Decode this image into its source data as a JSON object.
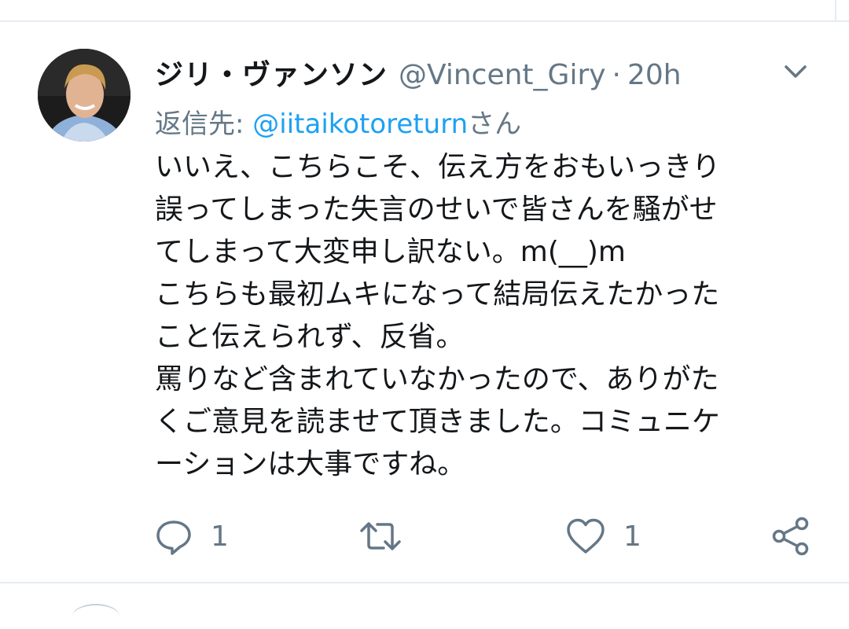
{
  "tweet": {
    "display_name": "ジリ・ヴァンソン",
    "handle": "@Vincent_Giry",
    "separator": "·",
    "time": "20h",
    "reply_prefix": "返信先: ",
    "reply_mention": "@iitaikotoreturn",
    "reply_suffix": "さん",
    "text_lines": [
      "いいえ、こちらこそ、伝え方をおもいっきり",
      "誤ってしまった失言のせいで皆さんを騒がせ",
      "てしまって大変申し訳ない。m(__)m",
      "こちらも最初ムキになって結局伝えたかった",
      "こと伝えられず、反省。",
      "罵りなど含まれていなかったので、ありがた",
      "くご意見を読ませて頂きました。コミュニケ",
      "ーションは大事ですね。"
    ]
  },
  "actions": {
    "reply_count": "1",
    "like_count": "1"
  },
  "icons": {
    "reply": "reply-bubble-icon",
    "retweet": "retweet-icon",
    "like": "heart-icon",
    "share": "share-icon",
    "menu": "chevron-down-icon"
  },
  "colors": {
    "text": "#14171a",
    "secondary": "#657786",
    "link": "#1da1f2",
    "divider": "#e6ecf0"
  }
}
